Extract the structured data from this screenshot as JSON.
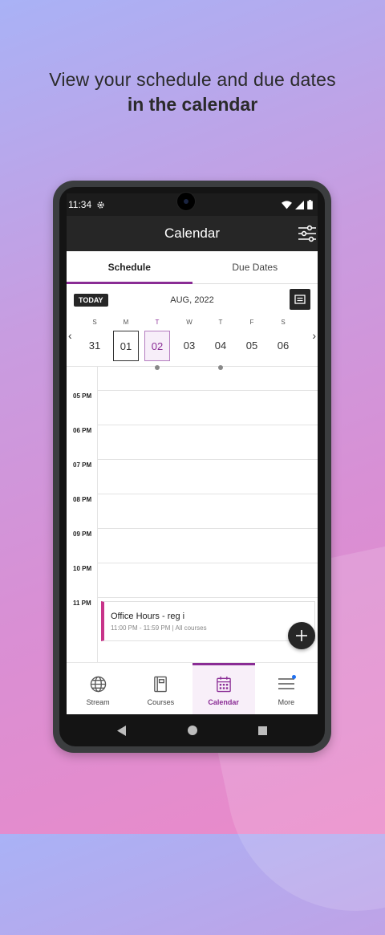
{
  "promo": {
    "line1": "View your schedule and due dates",
    "line2": "in the calendar"
  },
  "status": {
    "time": "11:34"
  },
  "appbar": {
    "title": "Calendar"
  },
  "tabs": [
    {
      "label": "Schedule"
    },
    {
      "label": "Due Dates"
    }
  ],
  "calendar": {
    "today_label": "TODAY",
    "month": "AUG, 2022",
    "days": [
      {
        "letter": "S",
        "num": "31"
      },
      {
        "letter": "M",
        "num": "01"
      },
      {
        "letter": "T",
        "num": "02"
      },
      {
        "letter": "W",
        "num": "03"
      },
      {
        "letter": "T",
        "num": "04"
      },
      {
        "letter": "F",
        "num": "05"
      },
      {
        "letter": "S",
        "num": "06"
      }
    ]
  },
  "timeline": {
    "hours": [
      "05 PM",
      "06 PM",
      "07 PM",
      "08 PM",
      "09 PM",
      "10 PM",
      "11 PM"
    ]
  },
  "event": {
    "title": "Office Hours - reg i",
    "subtitle": "11:00 PM - 11:59 PM | All courses"
  },
  "nav": [
    {
      "label": "Stream"
    },
    {
      "label": "Courses"
    },
    {
      "label": "Calendar"
    },
    {
      "label": "More"
    }
  ],
  "colors": {
    "accent": "#8a2c95",
    "event_bar": "#c8348a",
    "badge": "#1f6ff0"
  }
}
